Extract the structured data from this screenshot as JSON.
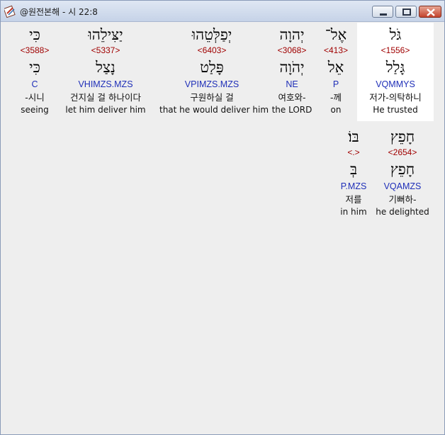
{
  "window": {
    "title": "@원전본해 - 시 22:8"
  },
  "words": [
    {
      "hebrew": "גֹּל",
      "strong": "<1556>",
      "lemma": "גָּלַל",
      "morph": "VQMMYS",
      "korean": "저가-의탁하니",
      "english": "He trusted",
      "highlighted": true
    },
    {
      "hebrew": "אֶל־",
      "strong": "<413>",
      "lemma": "אֵל",
      "morph": "P",
      "korean": "-께",
      "english": "on",
      "highlighted": false
    },
    {
      "hebrew": "יְהוָה",
      "strong": "<3068>",
      "lemma": "יְהֹוָה",
      "morph": "NE",
      "korean": "여호와-",
      "english": "the LORD",
      "highlighted": false
    },
    {
      "hebrew": "יְפַלְּטֵהוּ",
      "strong": "<6403>",
      "lemma": "פָּלַט",
      "morph": "VPIMZS.MZS",
      "korean": "구원하실 걸",
      "english": "that he would deliver him",
      "highlighted": false
    },
    {
      "hebrew": "יַצִּילֵהוּ",
      "strong": "<5337>",
      "lemma": "נָצַל",
      "morph": "VHIMZS.MZS",
      "korean": "건지실 걸 하나이다",
      "english": "let him deliver him",
      "highlighted": false
    },
    {
      "hebrew": "כִּי",
      "strong": "<3588>",
      "lemma": "כִּי",
      "morph": "C",
      "korean": "-시니",
      "english": "seeing",
      "highlighted": false
    },
    {
      "hebrew": "חָפֵץ",
      "strong": "<2654>",
      "lemma": "חָפֵץ",
      "morph": "VQAMZS",
      "korean": "기뻐하-",
      "english": "he delighted",
      "highlighted": false
    },
    {
      "hebrew": "בּוֹ׃",
      "strong": "<.>",
      "lemma": "בְּ",
      "morph": "P.MZS",
      "korean": "저를",
      "english": "in him",
      "highlighted": false
    }
  ]
}
